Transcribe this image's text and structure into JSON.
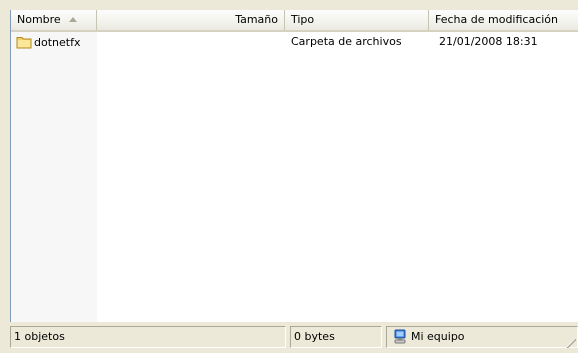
{
  "columns": {
    "name": "Nombre",
    "size": "Tamaño",
    "type": "Tipo",
    "modified": "Fecha de modificación"
  },
  "files": [
    {
      "name": "dotnetfx",
      "size": "",
      "type": "Carpeta de archivos",
      "modified": "21/01/2008 18:31",
      "icon": "folder-icon"
    }
  ],
  "status": {
    "count": "1 objetos",
    "size": "0 bytes",
    "zone": "Mi equipo",
    "zone_icon": "my-computer-icon"
  },
  "colors": {
    "header_bg": "#ebeae1",
    "frame": "#7f9db9",
    "folder": "#f2d064"
  }
}
